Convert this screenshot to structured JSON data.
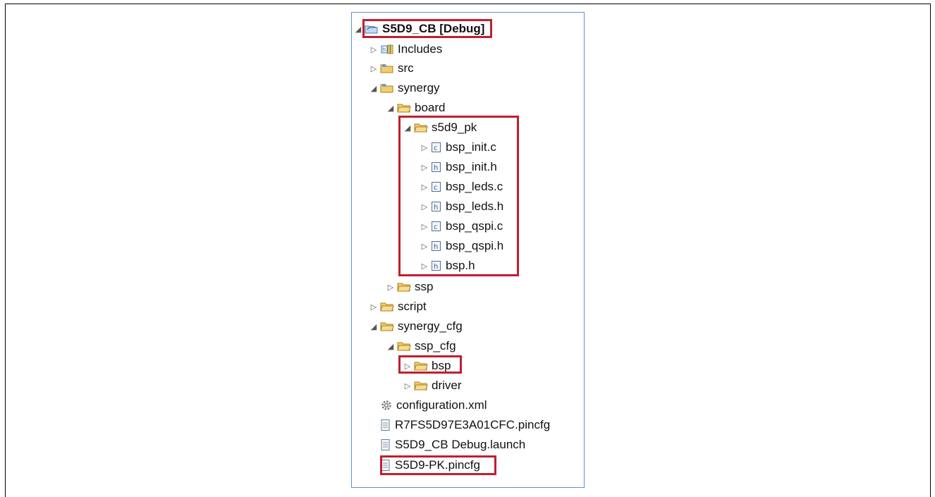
{
  "tree": {
    "root_label": "S5D9_CB [Debug]",
    "includes_label": "Includes",
    "src_label": "src",
    "synergy_label": "synergy",
    "board_label": "board",
    "s5d9_pk_label": "s5d9_pk",
    "board_files": [
      {
        "label": "bsp_init.c",
        "kind": "c"
      },
      {
        "label": "bsp_init.h",
        "kind": "h"
      },
      {
        "label": "bsp_leds.c",
        "kind": "c"
      },
      {
        "label": "bsp_leds.h",
        "kind": "h"
      },
      {
        "label": "bsp_qspi.c",
        "kind": "c"
      },
      {
        "label": "bsp_qspi.h",
        "kind": "h"
      },
      {
        "label": "bsp.h",
        "kind": "h"
      }
    ],
    "ssp_label": "ssp",
    "script_label": "script",
    "synergy_cfg_label": "synergy_cfg",
    "ssp_cfg_label": "ssp_cfg",
    "bsp_label": "bsp",
    "driver_label": "driver",
    "root_files": [
      {
        "label": "configuration.xml",
        "kind": "gear"
      },
      {
        "label": "R7FS5D97E3A01CFC.pincfg",
        "kind": "doc"
      },
      {
        "label": "S5D9_CB Debug.launch",
        "kind": "doc"
      },
      {
        "label": "S5D9-PK.pincfg",
        "kind": "doc"
      }
    ]
  },
  "colors": {
    "highlight": "#c01f2f",
    "panel_border": "#5b8fd6",
    "folder": "#e8b84a"
  }
}
